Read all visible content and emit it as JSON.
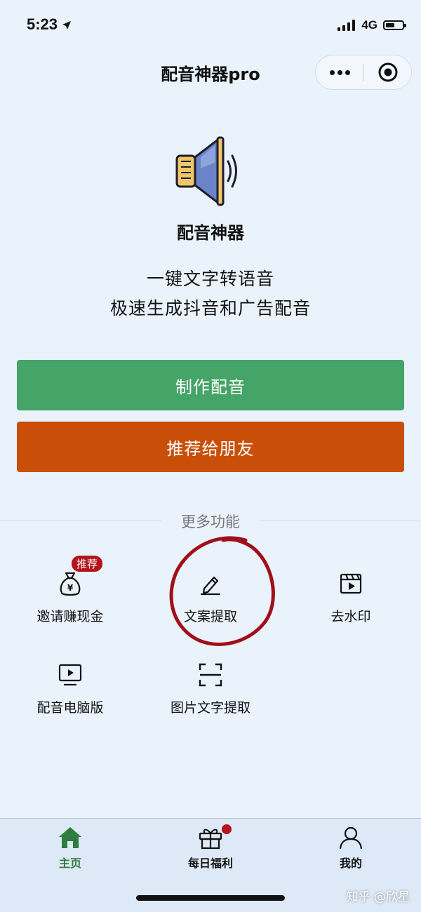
{
  "status_bar": {
    "time": "5:23",
    "network": "4G"
  },
  "nav": {
    "title": "配音神器pro"
  },
  "hero": {
    "app_name": "配音神器",
    "slogan_line1": "一键文字转语音",
    "slogan_line2": "极速生成抖音和广告配音"
  },
  "buttons": {
    "make_dubbing": "制作配音",
    "recommend": "推荐给朋友"
  },
  "more_section": {
    "title": "更多功能",
    "features": [
      {
        "label": "邀请赚现金",
        "icon": "money-bag-icon",
        "badge": "推荐"
      },
      {
        "label": "文案提取",
        "icon": "pencil-icon"
      },
      {
        "label": "去水印",
        "icon": "clapper-icon"
      },
      {
        "label": "配音电脑版",
        "icon": "monitor-play-icon"
      },
      {
        "label": "图片文字提取",
        "icon": "scan-frame-icon"
      }
    ]
  },
  "tab_bar": {
    "tabs": [
      {
        "label": "主页",
        "icon": "home-icon",
        "active": true
      },
      {
        "label": "每日福利",
        "icon": "gift-icon",
        "dot": true
      },
      {
        "label": "我的",
        "icon": "user-icon"
      }
    ]
  },
  "watermark": "知乎 @欣星",
  "colors": {
    "background": "#eaf3fc",
    "primary_green": "#45a467",
    "orange": "#c94f08",
    "badge_red": "#b4141c",
    "annotation_red": "#a0101a",
    "active_tab": "#2f7d3f"
  }
}
